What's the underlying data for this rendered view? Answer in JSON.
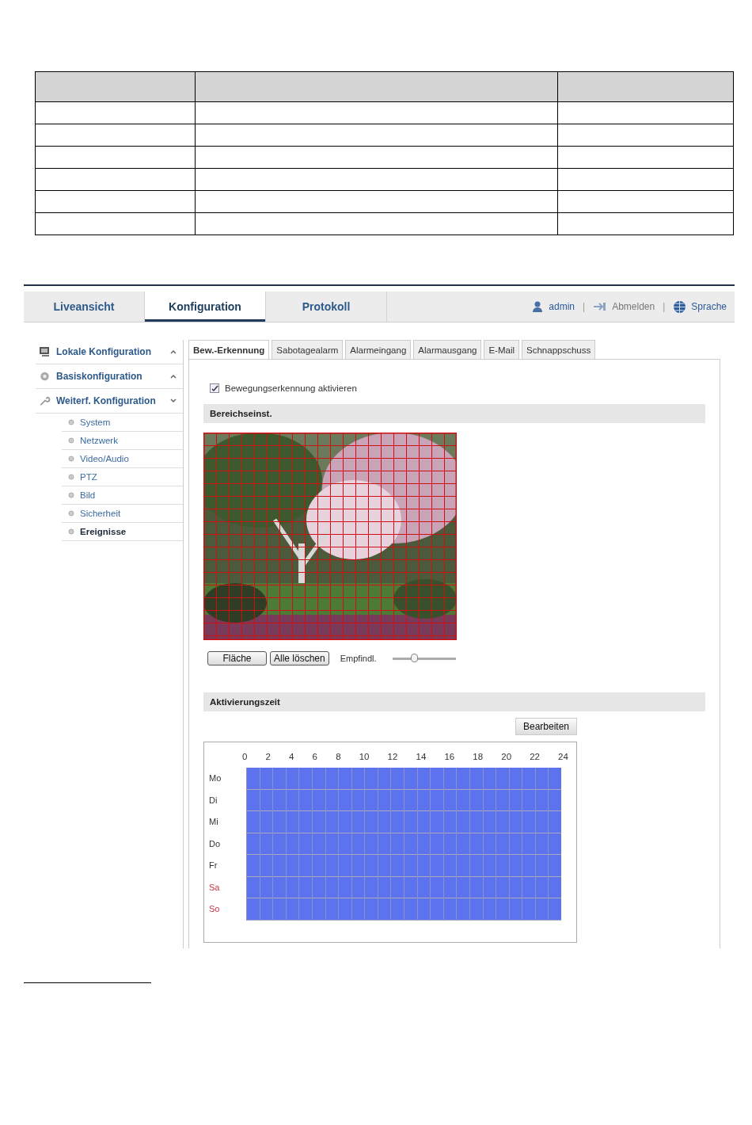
{
  "nav": {
    "tabs": [
      {
        "label": "Liveansicht",
        "selected": false
      },
      {
        "label": "Konfiguration",
        "selected": true
      },
      {
        "label": "Protokoll",
        "selected": false
      }
    ],
    "user": "admin",
    "separator": "|",
    "logout": "Abmelden",
    "separator_2": "|",
    "language": "Sprache"
  },
  "sidebar": {
    "items": [
      {
        "label": "Lokale Konfiguration",
        "expanded": false
      },
      {
        "label": "Basiskonfiguration",
        "expanded": false
      },
      {
        "label": "Weiterf. Konfiguration",
        "expanded": true,
        "children": [
          {
            "label": "System",
            "selected": false
          },
          {
            "label": "Netzwerk",
            "selected": false
          },
          {
            "label": "Video/Audio",
            "selected": false
          },
          {
            "label": "PTZ",
            "selected": false
          },
          {
            "label": "Bild",
            "selected": false
          },
          {
            "label": "Sicherheit",
            "selected": false
          },
          {
            "label": "Ereignisse",
            "selected": true
          }
        ]
      }
    ]
  },
  "tabs": [
    {
      "label": "Bew.-Erkennung",
      "selected": true
    },
    {
      "label": "Sabotagealarm",
      "selected": false
    },
    {
      "label": "Alarmeingang",
      "selected": false
    },
    {
      "label": "Alarmausgang",
      "selected": false
    },
    {
      "label": "E-Mail",
      "selected": false
    },
    {
      "label": "Schnappschuss",
      "selected": false
    }
  ],
  "enable": {
    "label": "Bewegungserkennung aktivieren",
    "checked": true
  },
  "area_section": {
    "title": "Bereichseinst.",
    "camera": {
      "kind": "picture"
    },
    "buttons": [
      "Fläche",
      "Alle löschen"
    ],
    "sensitivity": {
      "label": "Empfindl.",
      "level": 0.36
    }
  },
  "schedule_section": {
    "title": "Aktivierungszeit",
    "edit_button": "Bearbeiten",
    "hours": [
      "0",
      "2",
      "4",
      "6",
      "8",
      "10",
      "12",
      "14",
      "16",
      "18",
      "20",
      "22",
      "24"
    ],
    "days": [
      {
        "label": "Mo",
        "color": "#333333",
        "level": 1
      },
      {
        "label": "Di",
        "color": "#333333",
        "level": 1
      },
      {
        "label": "Mi",
        "color": "#333333",
        "level": 1
      },
      {
        "label": "Do",
        "color": "#333333",
        "level": 1
      },
      {
        "label": "Fr",
        "color": "#333333",
        "level": 1
      },
      {
        "label": "Sa",
        "color": "#cc3344",
        "level": 1
      },
      {
        "label": "So",
        "color": "#cc3344",
        "level": 1
      }
    ]
  }
}
